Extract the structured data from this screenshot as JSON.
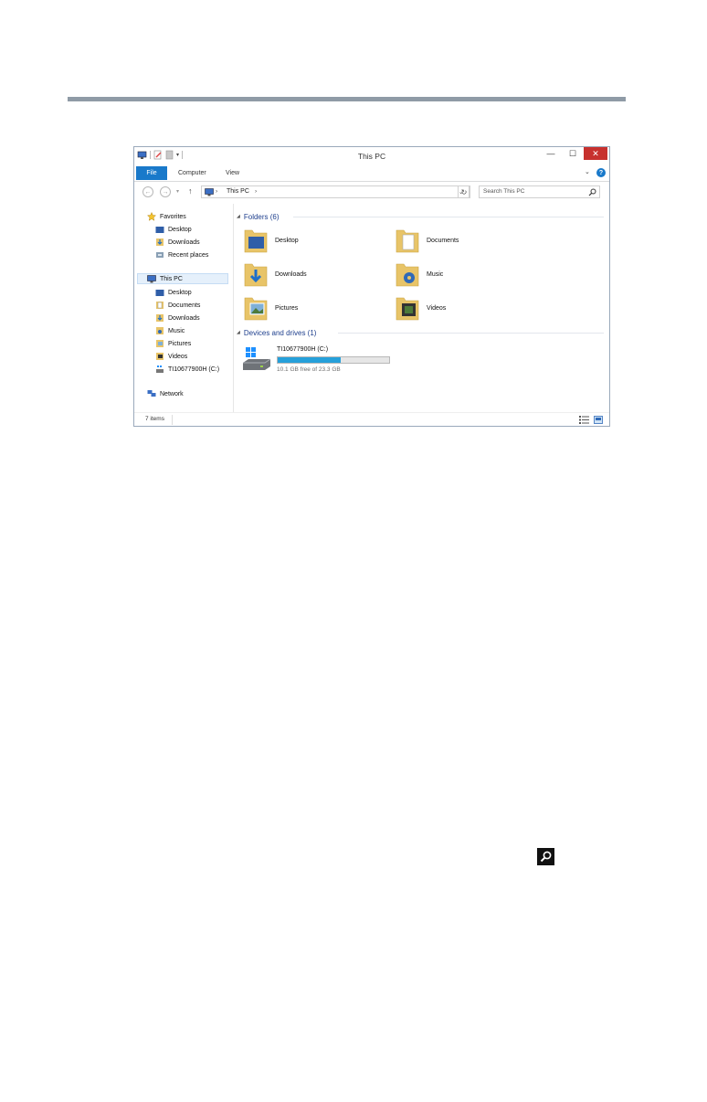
{
  "window": {
    "title": "This PC",
    "controls": {
      "minimize": "—",
      "maximize": "☐",
      "close": "✕"
    }
  },
  "ribbon": {
    "tabs": [
      "File",
      "Computer",
      "View"
    ],
    "help": "?"
  },
  "address_bar": {
    "path": "This PC",
    "search_placeholder": "Search This PC"
  },
  "nav_pane": {
    "favorites": {
      "label": "Favorites",
      "items": [
        "Desktop",
        "Downloads",
        "Recent places"
      ]
    },
    "this_pc": {
      "label": "This PC",
      "items": [
        "Desktop",
        "Documents",
        "Downloads",
        "Music",
        "Pictures",
        "Videos",
        "TI10677900H (C:)"
      ]
    },
    "network": "Network"
  },
  "content": {
    "folders_header": "Folders (6)",
    "folders": [
      "Desktop",
      "Documents",
      "Downloads",
      "Music",
      "Pictures",
      "Videos"
    ],
    "devices_header": "Devices and drives (1)",
    "drive": {
      "name": "TI10677900H (C:)",
      "free_text": "10.1 GB free of 23.3 GB",
      "used_fraction": 0.566
    }
  },
  "status": {
    "items": "7 items"
  },
  "colors": {
    "accent": "#1979ca",
    "close": "#c7312e",
    "header_text": "#1e3f8d",
    "drive_fill": "#26a0da"
  }
}
